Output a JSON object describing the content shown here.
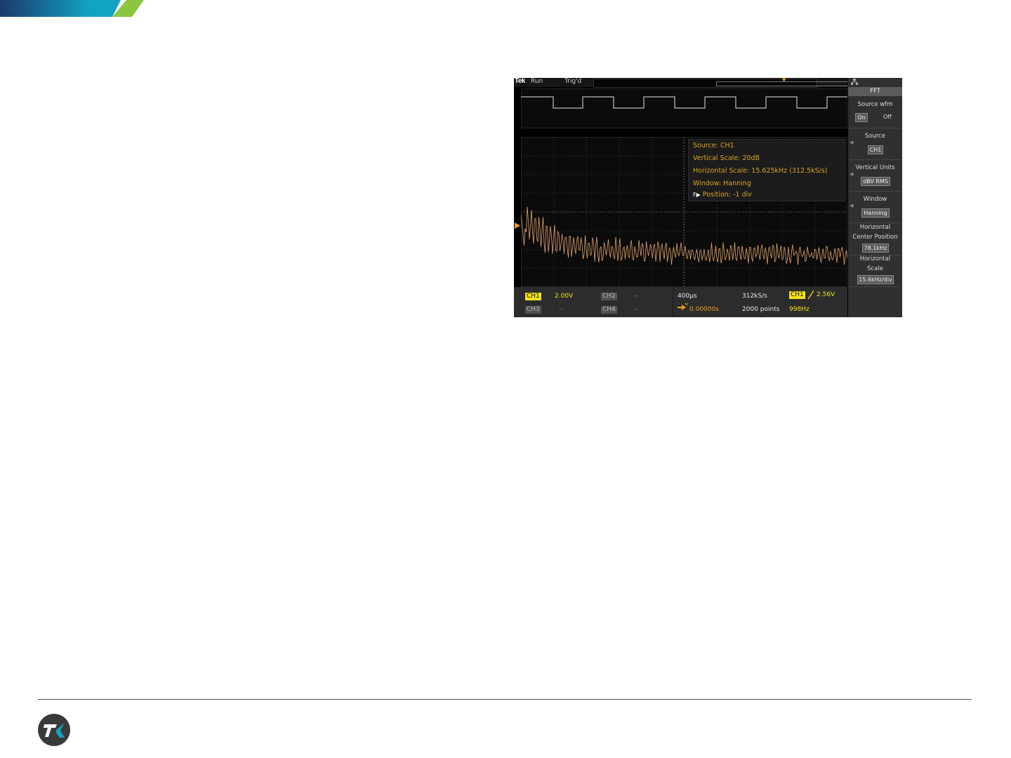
{
  "brand": {
    "navy": "#1b3a6b",
    "teal": "#12a3c4",
    "lime": "#8cc63f",
    "logo_icon": "tek-tk-logo-icon"
  },
  "scope": {
    "top_bar": {
      "logo": "Tek",
      "run_state": "Run",
      "trigger_state": "Trig'd"
    },
    "fft_overlay": {
      "source": "Source: CH1",
      "vertical_scale": "Vertical Scale: 20dB",
      "horizontal_scale": "Horizontal Scale: 15.625kHz (312.5kS/s)",
      "window": "Window: Hanning",
      "position_icon": "F▶",
      "position": "Position: -1 div"
    },
    "channels": {
      "ch1": {
        "label": "CH1",
        "value": "2.00V"
      },
      "ch2": {
        "label": "CH2",
        "value": "--"
      },
      "ch3": {
        "label": "CH3",
        "value": "--"
      },
      "ch4": {
        "label": "CH4",
        "value": "--"
      }
    },
    "horizontal": {
      "time_per_div": "400µs",
      "sample_rate": "312kS/s",
      "delay": "0.00000s",
      "record_length": "2000 points"
    },
    "trigger": {
      "source": "CH1",
      "slope_icon": "rising-edge-icon",
      "level": "2.56V",
      "frequency": "998Hz"
    },
    "side_menu": {
      "title": "FFT",
      "source_wfm_label": "Source wfm",
      "source_wfm_on": "On",
      "source_wfm_off": "Off",
      "source_label": "Source",
      "source_value": "CH1",
      "vertical_units_label": "Vertical Units",
      "vertical_units_value": "dBV RMS",
      "window_label": "Window",
      "window_value": "Hanning",
      "hcenter_label_1": "Horizontal",
      "hcenter_label_2": "Center Position",
      "hcenter_value": "78.1kHz",
      "hscale_label_1": "Horizontal",
      "hscale_label_2": "Scale",
      "hscale_value": "15.6kHz/div"
    }
  }
}
